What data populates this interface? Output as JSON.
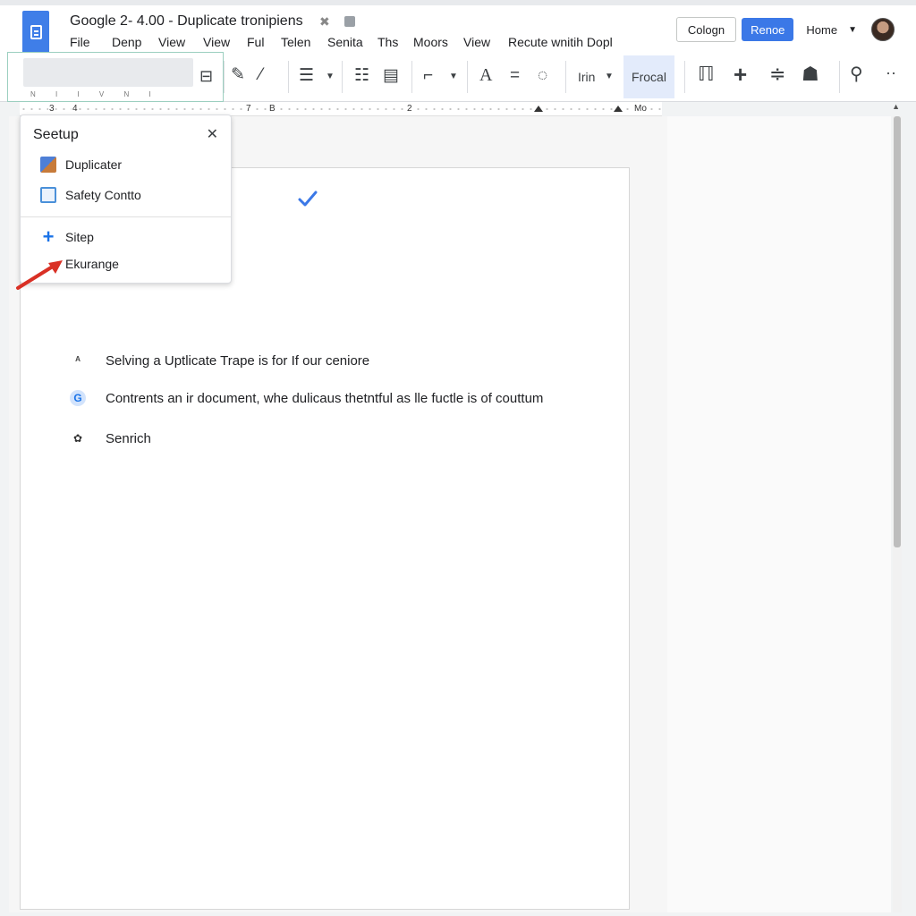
{
  "app": {
    "title": "Google 2- 4.00  -  Duplicate tronipiens",
    "menu": [
      "File",
      "Denp",
      "View",
      "View",
      "Ful",
      "Telen",
      "Senita",
      "Ths",
      "Moors",
      "View",
      "Recute wnitih Dopl"
    ],
    "buttons": {
      "cologn": "Cologn",
      "renoe": "Renoe"
    },
    "home": "Home",
    "colors": {
      "accent": "#3b78e7",
      "logo": "#3f7ee8",
      "focal_bg": "#e3ebfb",
      "arrow": "#d93025"
    }
  },
  "toolbar": {
    "hint_chars": "N  I  I  V  N  I",
    "font_label": "Irin",
    "focal_label": "Frocal",
    "icons": [
      "frame-icon",
      "pen-icon",
      "brush-icon",
      "list-icon",
      "bullet-list-icon",
      "table-icon",
      "corner-icon",
      "font-a-icon",
      "equals-icon",
      "circle-dashed-icon",
      "person-lines-icon",
      "plus-icon",
      "align-center-icon",
      "user-icon",
      "walk-icon",
      "more-icon"
    ]
  },
  "ruler": {
    "labels": [
      "3",
      "4",
      "7",
      "B",
      "2",
      "Mo"
    ]
  },
  "popup": {
    "title": "Seetup",
    "items": [
      {
        "label": "Duplicater",
        "icon": "duplicate-icon"
      },
      {
        "label": "Safety Contto",
        "icon": "safety-icon"
      },
      {
        "label": "Sitep",
        "icon": "plus-icon"
      },
      {
        "label": "Ekurange",
        "icon": ""
      }
    ]
  },
  "document": {
    "rows": [
      {
        "icon": "text-icon",
        "text": "Selving a Uptlicate Trape is for If our ceniore"
      },
      {
        "icon": "g-icon",
        "text": "Contrents an ir document, whe dulicaus thetntful as lle fuctle is of couttum"
      },
      {
        "icon": "search-icon",
        "text": "Senrich"
      }
    ]
  }
}
